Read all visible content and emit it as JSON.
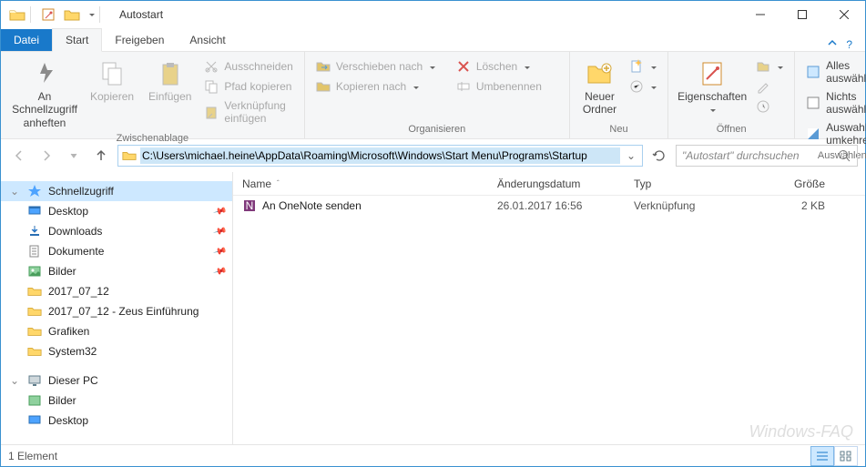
{
  "window": {
    "title": "Autostart"
  },
  "tabs": {
    "file": "Datei",
    "home": "Start",
    "share": "Freigeben",
    "view": "Ansicht"
  },
  "ribbon": {
    "clipboard": {
      "pin": "An Schnellzugriff anheften",
      "copy": "Kopieren",
      "paste": "Einfügen",
      "cut": "Ausschneiden",
      "copy_path": "Pfad kopieren",
      "paste_shortcut": "Verknüpfung einfügen",
      "label": "Zwischenablage"
    },
    "organize": {
      "move_to": "Verschieben nach",
      "copy_to": "Kopieren nach",
      "delete": "Löschen",
      "rename": "Umbenennen",
      "label": "Organisieren"
    },
    "new": {
      "new_folder": "Neuer Ordner",
      "label": "Neu"
    },
    "open": {
      "properties": "Eigenschaften",
      "label": "Öffnen"
    },
    "select": {
      "select_all": "Alles auswählen",
      "select_none": "Nichts auswählen",
      "invert": "Auswahl umkehren",
      "label": "Auswählen"
    }
  },
  "address": {
    "path": "C:\\Users\\michael.heine\\AppData\\Roaming\\Microsoft\\Windows\\Start Menu\\Programs\\Startup"
  },
  "search": {
    "placeholder": "\"Autostart\" durchsuchen"
  },
  "nav": {
    "quick_access": "Schnellzugriff",
    "items": [
      {
        "label": "Desktop",
        "pinned": true,
        "icon": "desktop"
      },
      {
        "label": "Downloads",
        "pinned": true,
        "icon": "downloads"
      },
      {
        "label": "Dokumente",
        "pinned": true,
        "icon": "documents"
      },
      {
        "label": "Bilder",
        "pinned": true,
        "icon": "pictures"
      },
      {
        "label": "2017_07_12",
        "pinned": false,
        "icon": "folder"
      },
      {
        "label": "2017_07_12 - Zeus Einführung",
        "pinned": false,
        "icon": "folder"
      },
      {
        "label": "Grafiken",
        "pinned": false,
        "icon": "folder"
      },
      {
        "label": "System32",
        "pinned": false,
        "icon": "folder"
      }
    ],
    "this_pc": "Dieser PC",
    "pc_items": [
      {
        "label": "Bilder",
        "icon": "pictures"
      },
      {
        "label": "Desktop",
        "icon": "desktop"
      }
    ]
  },
  "columns": {
    "name": "Name",
    "modified": "Änderungsdatum",
    "type": "Typ",
    "size": "Größe"
  },
  "files": [
    {
      "name": "An OneNote senden",
      "modified": "26.01.2017 16:56",
      "type": "Verknüpfung",
      "size": "2 KB"
    }
  ],
  "status": {
    "count": "1 Element"
  },
  "watermark": "Windows-FAQ"
}
